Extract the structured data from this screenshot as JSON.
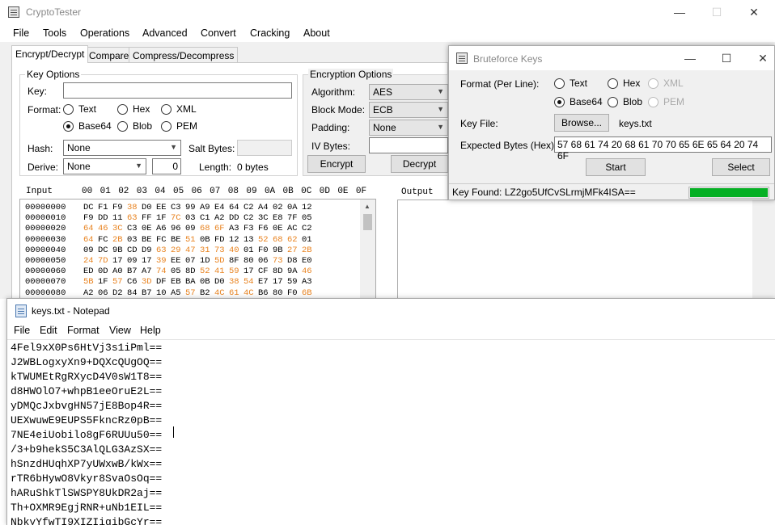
{
  "main": {
    "title": "CryptoTester",
    "menu": [
      "File",
      "Tools",
      "Operations",
      "Advanced",
      "Convert",
      "Cracking",
      "About"
    ],
    "tabs": [
      "Encrypt/Decrypt",
      "Compare",
      "Compress/Decompress"
    ],
    "key_options": {
      "title": "Key Options",
      "key_label": "Key:",
      "key_value": "",
      "format_label": "Format:",
      "format_options": [
        "Text",
        "Hex",
        "XML",
        "Base64",
        "Blob",
        "PEM"
      ],
      "format_selected": "Base64",
      "hash_label": "Hash:",
      "hash_value": "None",
      "salt_label": "Salt Bytes:",
      "derive_label": "Derive:",
      "derive_value": "None",
      "derive_number": "0",
      "length_label": "Length:",
      "length_value": "0 bytes"
    },
    "encryption_options": {
      "title": "Encryption Options",
      "algorithm_label": "Algorithm:",
      "algorithm_value": "AES",
      "block_mode_label": "Block Mode:",
      "block_mode_value": "ECB",
      "padding_label": "Padding:",
      "padding_value": "None",
      "iv_label": "IV Bytes:",
      "encrypt_label": "Encrypt",
      "decrypt_label": "Decrypt"
    },
    "input_label": "Input",
    "output_label": "Output",
    "hex_header": [
      "00",
      "01",
      "02",
      "03",
      "04",
      "05",
      "06",
      "07",
      "08",
      "09",
      "0A",
      "0B",
      "0C",
      "0D",
      "0E",
      "0F"
    ],
    "hex_rows": [
      {
        "offset": "00000000",
        "bytes": [
          "DC",
          "F1",
          "F9",
          "38",
          "D0",
          "EE",
          "C3",
          "99",
          "A9",
          "E4",
          "64",
          "C2",
          "A4",
          "02",
          "0A",
          "12"
        ]
      },
      {
        "offset": "00000010",
        "bytes": [
          "F9",
          "DD",
          "11",
          "63",
          "FF",
          "1F",
          "7C",
          "03",
          "C1",
          "A2",
          "DD",
          "C2",
          "3C",
          "E8",
          "7F",
          "05"
        ]
      },
      {
        "offset": "00000020",
        "bytes": [
          "64",
          "46",
          "3C",
          "C3",
          "0E",
          "A6",
          "96",
          "09",
          "68",
          "6F",
          "A3",
          "F3",
          "F6",
          "0E",
          "AC",
          "C2"
        ]
      },
      {
        "offset": "00000030",
        "bytes": [
          "64",
          "FC",
          "2B",
          "03",
          "BE",
          "FC",
          "BE",
          "51",
          "0B",
          "FD",
          "12",
          "13",
          "52",
          "68",
          "62",
          "01"
        ]
      },
      {
        "offset": "00000040",
        "bytes": [
          "09",
          "DC",
          "9B",
          "CD",
          "D9",
          "63",
          "29",
          "47",
          "31",
          "73",
          "40",
          "01",
          "F0",
          "9B",
          "27",
          "2B"
        ]
      },
      {
        "offset": "00000050",
        "bytes": [
          "24",
          "7D",
          "17",
          "09",
          "17",
          "39",
          "EE",
          "07",
          "1D",
          "5D",
          "8F",
          "80",
          "06",
          "73",
          "D8",
          "E0"
        ]
      },
      {
        "offset": "00000060",
        "bytes": [
          "ED",
          "0D",
          "A0",
          "B7",
          "A7",
          "74",
          "05",
          "8D",
          "52",
          "41",
          "59",
          "17",
          "CF",
          "8D",
          "9A",
          "46"
        ]
      },
      {
        "offset": "00000070",
        "bytes": [
          "5B",
          "1F",
          "57",
          "C6",
          "3D",
          "DF",
          "EB",
          "BA",
          "0B",
          "D0",
          "38",
          "54",
          "E7",
          "17",
          "59",
          "A3"
        ]
      },
      {
        "offset": "00000080",
        "bytes": [
          "A2",
          "06",
          "D2",
          "84",
          "B7",
          "10",
          "A5",
          "57",
          "B2",
          "4C",
          "61",
          "4C",
          "B6",
          "80",
          "F0",
          "6B"
        ]
      }
    ],
    "hex_highlight_color": "#e8821e"
  },
  "bruteforce": {
    "title": "Bruteforce Keys",
    "format_label": "Format (Per Line):",
    "format_options": [
      "Text",
      "Hex",
      "XML",
      "Base64",
      "Blob",
      "PEM"
    ],
    "format_selected": "Base64",
    "key_file_label": "Key File:",
    "browse_label": "Browse...",
    "key_file_name": "keys.txt",
    "expected_label": "Expected Bytes (Hex):",
    "expected_value": "57 68 61 74 20 68 61 70 70 65 6E 65 64 20 74 6F",
    "start_label": "Start",
    "select_label": "Select",
    "status_text": "Key Found: LZ2go5UfCvSLrmjMFk4ISA==",
    "progress": 1.0,
    "progress_color": "#06b025"
  },
  "notepad": {
    "title": "keys.txt - Notepad",
    "menu": [
      "File",
      "Edit",
      "Format",
      "View",
      "Help"
    ],
    "lines": [
      "4Fel9xX0Ps6HtVj3s1iPml==",
      "J2WBLogxyXn9+DQXcQUgOQ==",
      "kTWUMEtRgRXycD4V0sW1T8==",
      "d8HWOlO7+whpB1eeOruE2L==",
      "yDMQcJxbvgHN57jE8Bop4R==",
      "UEXwuwE9EUPS5FkncRz0pB==",
      "7NE4eiUobilo8gF6RUUu50==",
      "/3+b9hekS5C3AlQLG3AzSX==",
      "hSnzdHUqhXP7yUWxwB/kWx==",
      "rTR6bHywO8Vkyr8SvaOsOq==",
      "hARuShkTlSWSPY8UkDR2aj==",
      "Th+OXMR9EgjRNR+uNb1EIL==",
      "NbkyYfwTI9XIZIigibGcYr=="
    ]
  }
}
